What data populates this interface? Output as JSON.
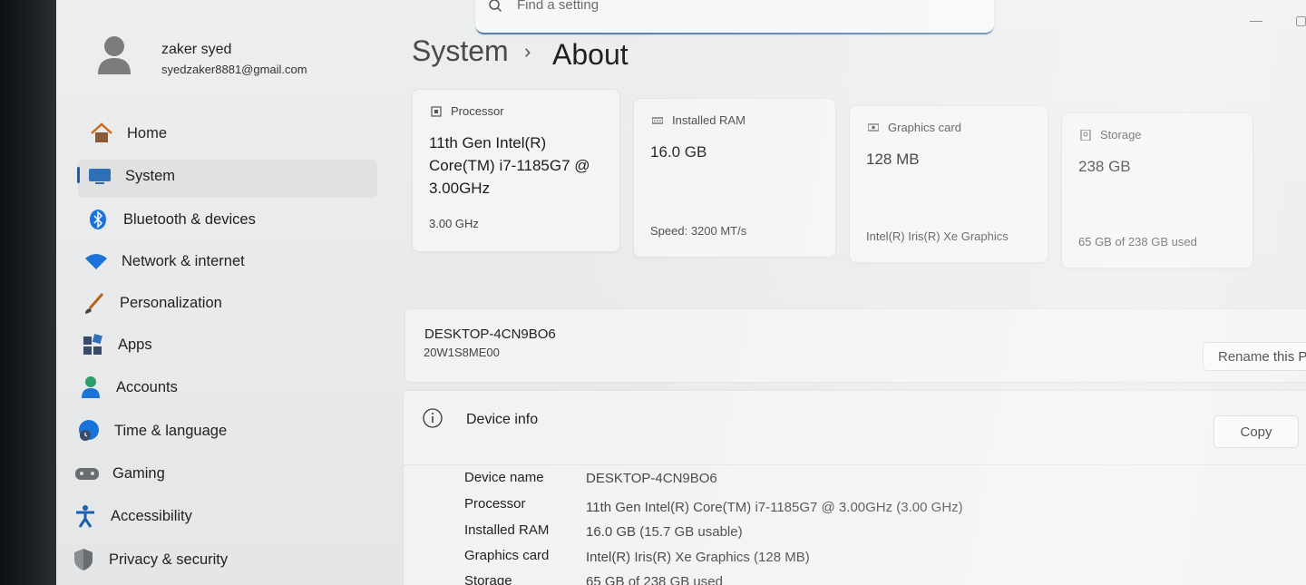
{
  "search": {
    "placeholder": "Find a setting"
  },
  "window": {
    "minimize": "—",
    "restore": "▢"
  },
  "profile": {
    "name": "zaker syed",
    "email": "syedzaker8881@gmail.com"
  },
  "sidebar": {
    "items": [
      {
        "label": "Home",
        "icon": "home-icon"
      },
      {
        "label": "System",
        "icon": "system-icon",
        "selected": true
      },
      {
        "label": "Bluetooth & devices",
        "icon": "bluetooth-icon"
      },
      {
        "label": "Network & internet",
        "icon": "wifi-icon"
      },
      {
        "label": "Personalization",
        "icon": "brush-icon"
      },
      {
        "label": "Apps",
        "icon": "apps-icon"
      },
      {
        "label": "Accounts",
        "icon": "account-icon"
      },
      {
        "label": "Time & language",
        "icon": "globe-clock-icon"
      },
      {
        "label": "Gaming",
        "icon": "gamepad-icon"
      },
      {
        "label": "Accessibility",
        "icon": "accessibility-icon"
      },
      {
        "label": "Privacy & security",
        "icon": "shield-icon"
      }
    ]
  },
  "breadcrumb": {
    "parent": "System",
    "separator": "›",
    "current": "About"
  },
  "specs_cards": [
    {
      "label": "Processor",
      "value": "11th Gen Intel(R) Core(TM) i7-1185G7 @ 3.00GHz",
      "sub": "3.00 GHz"
    },
    {
      "label": "Installed RAM",
      "value": "16.0 GB",
      "sub": "Speed: 3200 MT/s"
    },
    {
      "label": "Graphics card",
      "value": "128 MB",
      "sub": "Intel(R) Iris(R) Xe Graphics"
    },
    {
      "label": "Storage",
      "value": "238 GB",
      "sub": "65 GB of 238 GB used"
    }
  ],
  "device": {
    "name": "DESKTOP-4CN9BO6",
    "model": "20W1S8ME00",
    "rename_button": "Rename this PC"
  },
  "device_info": {
    "title": "Device info",
    "copy_button": "Copy",
    "rows": [
      {
        "key": "Device name",
        "value": "DESKTOP-4CN9BO6"
      },
      {
        "key": "Processor",
        "value": "11th Gen Intel(R) Core(TM) i7-1185G7 @ 3.00GHz (3.00 GHz)"
      },
      {
        "key": "Installed RAM",
        "value": "16.0 GB (15.7 GB usable)"
      },
      {
        "key": "Graphics card",
        "value": "Intel(R) Iris(R) Xe Graphics (128 MB)"
      },
      {
        "key": "Storage",
        "value": "65 GB of 238 GB used"
      }
    ]
  },
  "colors": {
    "accent": "#1d5fa8",
    "background": "#eceeef"
  }
}
